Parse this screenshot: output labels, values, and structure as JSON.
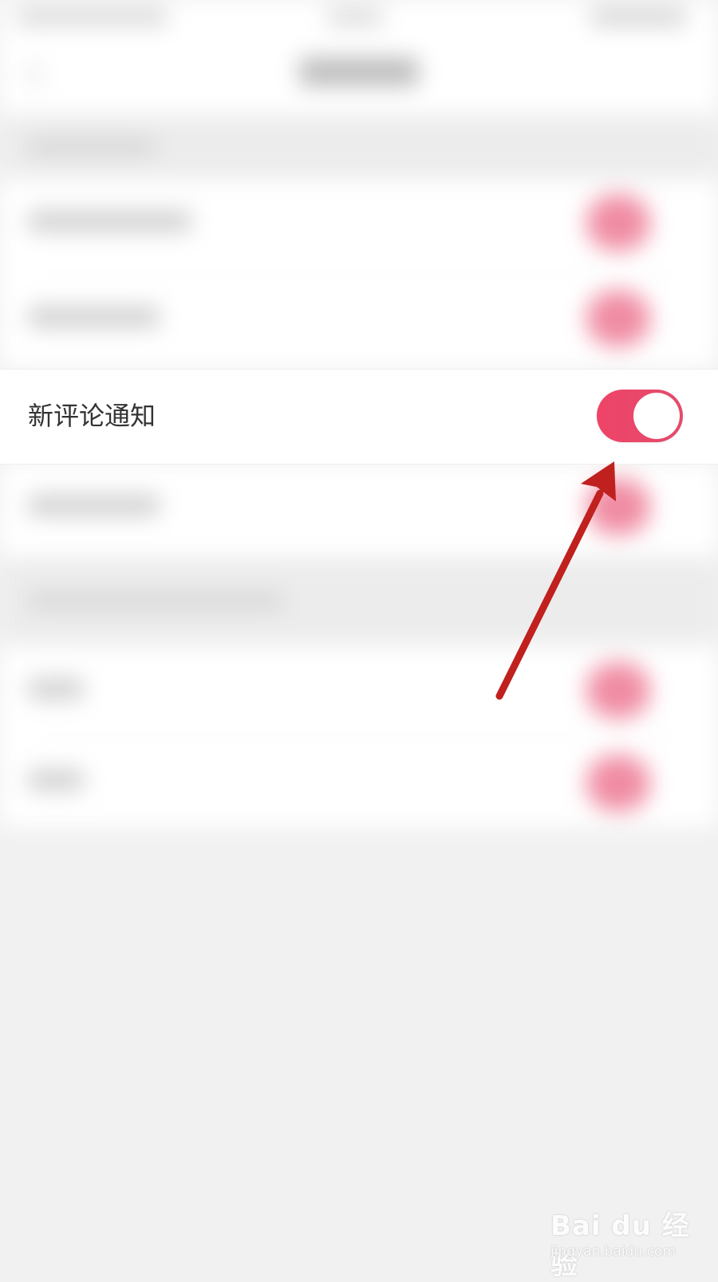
{
  "settings": {
    "focused_row": {
      "label": "新评论通知",
      "switch_on": true
    }
  },
  "colors": {
    "accent": "#ee4468",
    "annotation_arrow": "#c0201e"
  },
  "watermark": {
    "main": "Bai du 经验",
    "sub": "jingyan.baidu.com"
  }
}
